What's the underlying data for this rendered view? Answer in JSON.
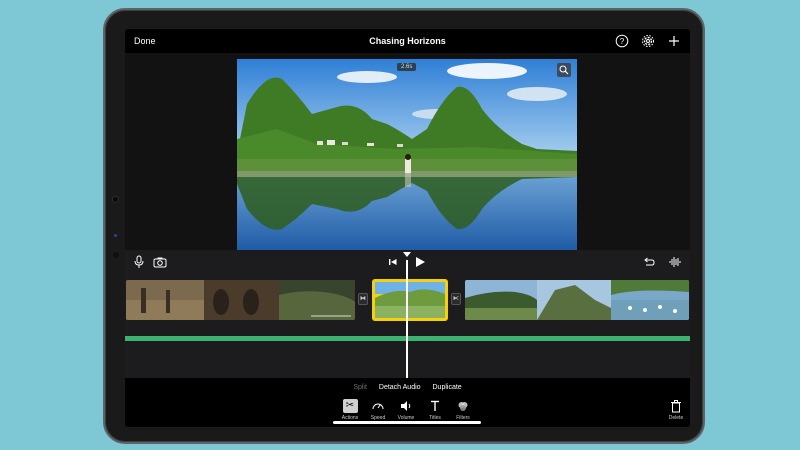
{
  "app": {
    "done_label": "Done",
    "project_title": "Chasing Horizons"
  },
  "top_icons": [
    "help-icon",
    "gear-icon",
    "plus-icon"
  ],
  "viewer": {
    "speed_badge": "2.6s",
    "zoom_icon": "magnify-icon"
  },
  "controls": {
    "left": [
      "microphone-icon",
      "camera-icon"
    ],
    "center": [
      "skip-to-start-icon",
      "play-icon"
    ],
    "right": [
      "undo-icon",
      "audio-waveform-icon"
    ]
  },
  "sub_actions": {
    "split": "Split",
    "detach_audio": "Detach Audio",
    "duplicate": "Duplicate"
  },
  "tools": [
    {
      "label": "Actions",
      "icon": "scissors-icon",
      "active": true
    },
    {
      "label": "Speed",
      "icon": "speedometer-icon",
      "active": false
    },
    {
      "label": "Volume",
      "icon": "speaker-icon",
      "active": false
    },
    {
      "label": "Titles",
      "icon": "text-icon",
      "active": false
    },
    {
      "label": "Filters",
      "icon": "filters-icon",
      "active": false
    }
  ],
  "delete_label": "Delete",
  "colors": {
    "selection": "#f4d10c",
    "audio_track": "#3cb371",
    "background": "#7ec8d6"
  }
}
